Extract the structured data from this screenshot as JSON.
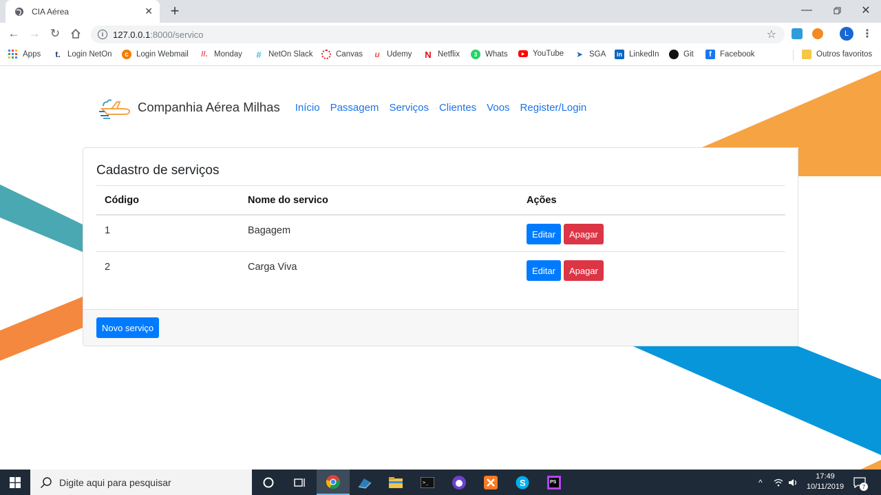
{
  "browser": {
    "tab_title": "CIA Aérea",
    "url_host": "127.0.0.1",
    "url_path": ":8000/servico",
    "bookmarks": [
      "Apps",
      "Login NetOn",
      "Login Webmail",
      "Monday",
      "NetOn Slack",
      "Canvas",
      "Udemy",
      "Netflix",
      "Whats",
      "YouTube",
      "SGA",
      "LinkedIn",
      "Git",
      "Facebook"
    ],
    "other_bookmarks": "Outros favoritos",
    "profile_initial": "L"
  },
  "site": {
    "brand": "Companhia Aérea Milhas",
    "nav": [
      "Início",
      "Passagem",
      "Serviços",
      "Clientes",
      "Voos",
      "Register/Login"
    ]
  },
  "card": {
    "title": "Cadastro de serviços",
    "headers": [
      "Código",
      "Nome do servico",
      "Ações"
    ],
    "rows": [
      {
        "code": "1",
        "name": "Bagagem"
      },
      {
        "code": "2",
        "name": "Carga Viva"
      }
    ],
    "edit_label": "Editar",
    "delete_label": "Apagar",
    "new_button": "Novo serviço"
  },
  "taskbar": {
    "search_placeholder": "Digite aqui para pesquisar",
    "time": "17:49",
    "date": "10/11/2019",
    "notifications": "7"
  },
  "colors": {
    "primary": "#007bff",
    "danger": "#dc3545",
    "stripe_orange": "#f6a343",
    "stripe_teal": "#4aa8b2",
    "stripe_blue": "#0896db"
  }
}
